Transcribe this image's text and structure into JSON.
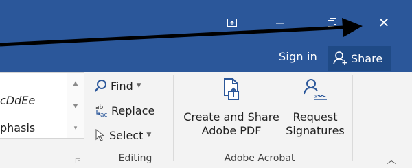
{
  "titlebar": {
    "bg_color": "#2b579a",
    "buttons": {
      "restore_down_icon": "ribbon-display-options-icon",
      "minimize_icon": "minimize-icon",
      "maximize_icon": "restore-icon",
      "close_label": "✕"
    }
  },
  "header": {
    "sign_in": "Sign in",
    "share": "Share"
  },
  "styles_gallery": {
    "item1": "cDdEe",
    "item2": "phasis"
  },
  "editing": {
    "find": "Find",
    "replace": "Replace",
    "select": "Select",
    "group_label": "Editing"
  },
  "acrobat": {
    "create_line1": "Create and Share",
    "create_line2": "Adobe PDF",
    "request_line1": "Request",
    "request_line2": "Signatures",
    "group_label": "Adobe Acrobat",
    "icon_color": "#2b579a"
  },
  "annotation": {
    "arrow_color": "#000000"
  }
}
